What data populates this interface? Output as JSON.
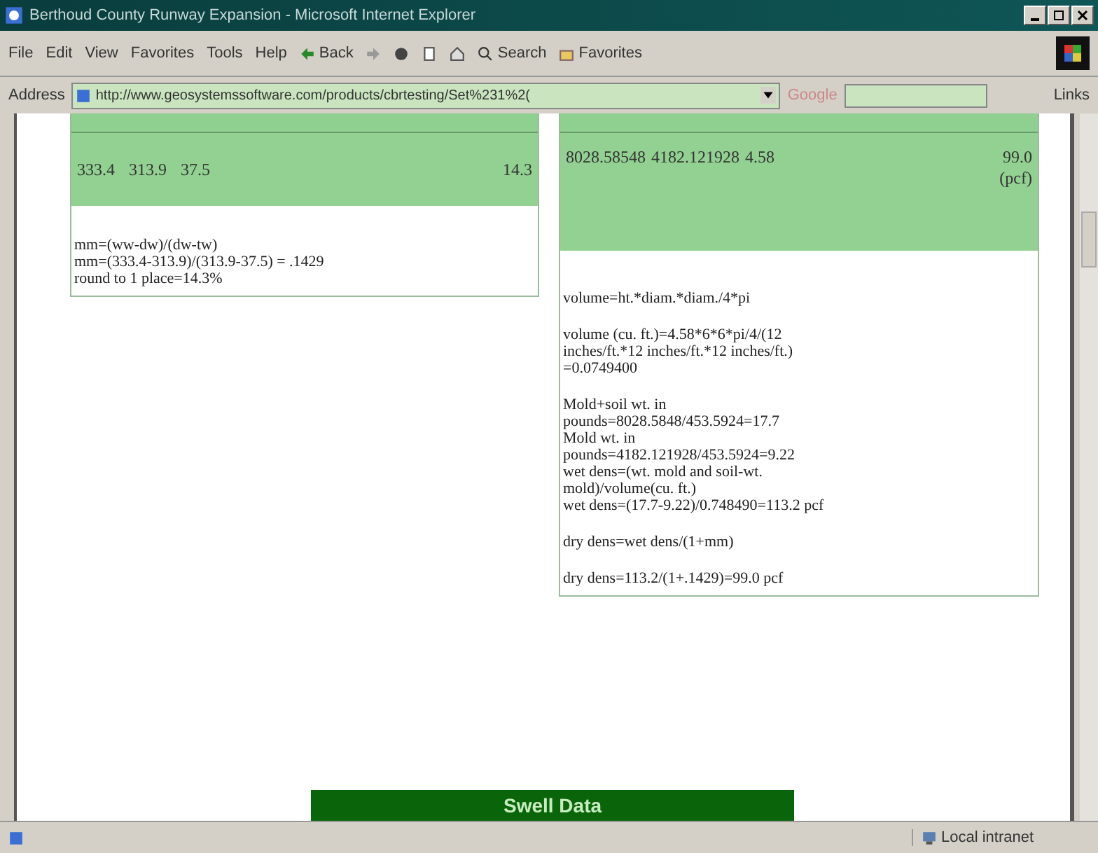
{
  "window": {
    "title": "Berthoud County Runway Expansion - Microsoft Internet Explorer"
  },
  "menu": [
    "File",
    "Edit",
    "View",
    "Favorites",
    "Tools",
    "Help"
  ],
  "toolbar": {
    "back": "Back",
    "search": "Search",
    "favorites": "Favorites"
  },
  "address": {
    "label": "Address",
    "value": "http://www.geosystemssoftware.com/products/cbrtesting/Set%231%2(",
    "google": "Google",
    "links": "Links"
  },
  "moisture_table": {
    "values": [
      "333.4",
      "313.9",
      "37.5",
      "14.3"
    ],
    "notes": [
      [
        "mm=(ww-dw)/(dw-tw)",
        "mm=(333.4-313.9)/(313.9-37.5) = .1429",
        "round to 1 place=14.3%"
      ]
    ]
  },
  "density_table": {
    "values": [
      "8028.58548",
      "4182.121928",
      "4.58",
      "99.0 (pcf)"
    ],
    "notes": [
      [
        "volume=ht.*diam.*diam./4*pi"
      ],
      [
        "volume (cu. ft.)=4.58*6*6*pi/4/(12",
        "inches/ft.*12 inches/ft.*12 inches/ft.)",
        "=0.0749400"
      ],
      [
        "Mold+soil wt. in",
        "pounds=8028.5848/453.5924=17.7",
        "Mold wt. in",
        "pounds=4182.121928/453.5924=9.22",
        "wet dens=(wt. mold and soil-wt.",
        "mold)/volume(cu. ft.)",
        "wet dens=(17.7-9.22)/0.748490=113.2 pcf"
      ],
      [
        "dry dens=wet dens/(1+mm)"
      ],
      [
        "dry dens=113.2/(1+.1429)=99.0 pcf"
      ]
    ]
  },
  "section_heading": "Swell Data",
  "status_bar": {
    "zone": "Local intranet"
  }
}
